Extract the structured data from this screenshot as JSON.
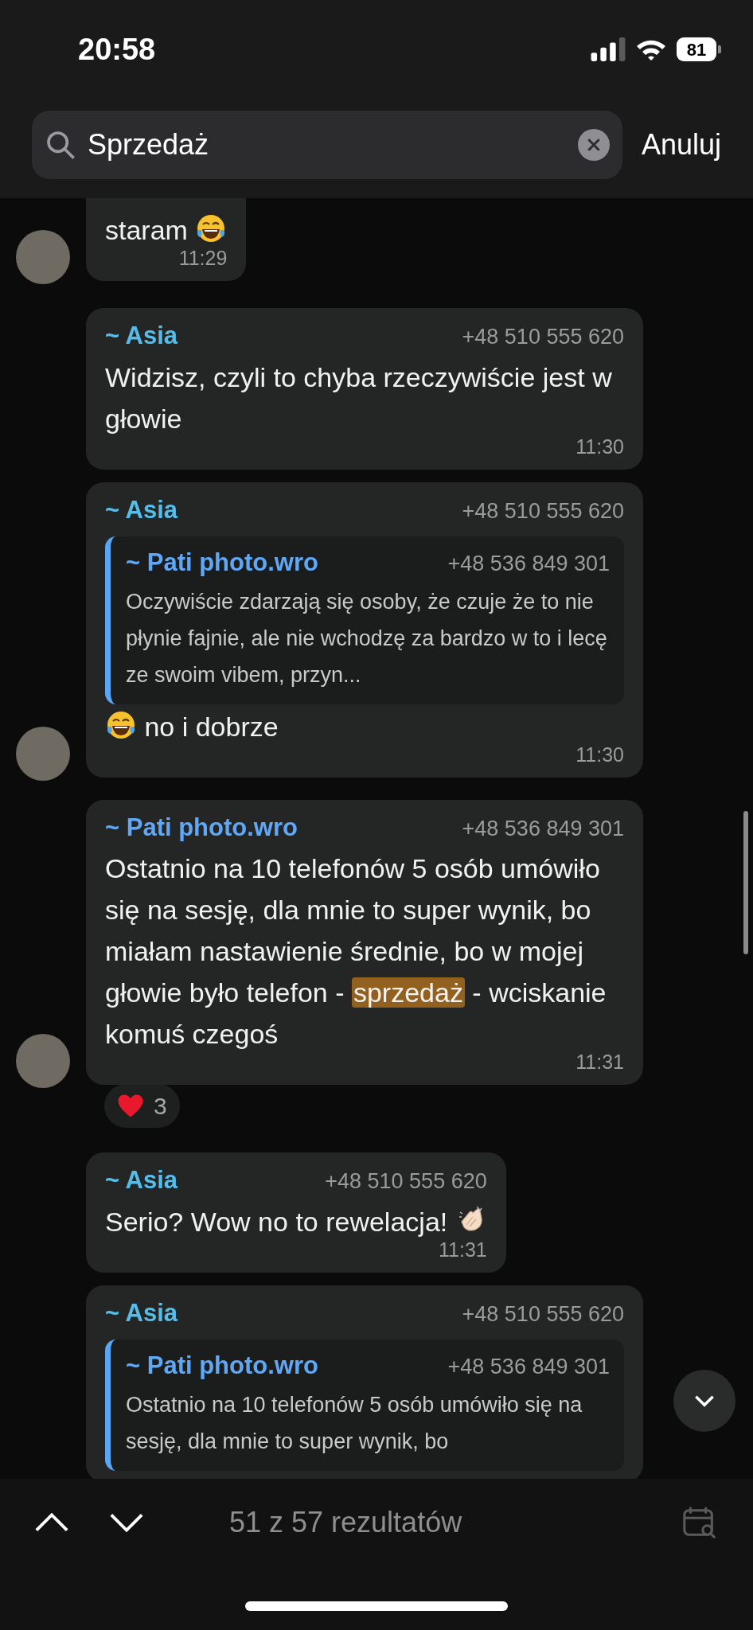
{
  "status_bar": {
    "time": "20:58",
    "battery": "81"
  },
  "search": {
    "value": "Sprzedaż",
    "cancel": "Anuluj"
  },
  "messages": [
    {
      "avatar": true,
      "time": "11:29",
      "segments": [
        {
          "kind": "text",
          "text": "staram "
        },
        {
          "kind": "laugh-emoji"
        }
      ]
    },
    {
      "avatar": false,
      "sender": "~ Asia",
      "color": "#53bdeb",
      "phone": "+48 510 555 620",
      "time": "11:30",
      "segments": [
        {
          "kind": "text",
          "text": "Widzisz, czyli to chyba rzeczywiście jest w głowie"
        }
      ]
    },
    {
      "avatar": true,
      "sender": "~ Asia",
      "color": "#53bdeb",
      "phone": "+48 510 555 620",
      "time": "11:30",
      "quote": {
        "sender": "~ Pati photo.wro",
        "phone": "+48 536 849 301",
        "text": "Oczywiście zdarzają się osoby, że czuje że to nie płynie fajnie, ale nie wchodzę za bardzo w to i lecę ze swoim vibem, przyn..."
      },
      "segments": [
        {
          "kind": "laugh-emoji"
        },
        {
          "kind": "text",
          "text": " no i dobrze"
        }
      ]
    },
    {
      "avatar": true,
      "sender": "~ Pati photo.wro",
      "color": "#5ea8f7",
      "phone": "+48 536 849 301",
      "time": "11:31",
      "segments": [
        {
          "kind": "text",
          "text": "Ostatnio na 10 telefonów 5 osób umówiło się na sesję, dla mnie to super wynik, bo miałam nastawienie średnie, bo w mojej głowie było telefon - "
        },
        {
          "kind": "highlight",
          "text": "sprzedaż"
        },
        {
          "kind": "text",
          "text": " - wciskanie komuś czegoś"
        }
      ],
      "reaction": {
        "count": "3"
      }
    },
    {
      "avatar": false,
      "sender": "~ Asia",
      "color": "#53bdeb",
      "phone": "+48 510 555 620",
      "time": "11:31",
      "segments": [
        {
          "kind": "text",
          "text": "Serio? Wow no to rewelacja! "
        },
        {
          "kind": "clap-emoji"
        }
      ]
    },
    {
      "avatar": false,
      "sender": "~ Asia",
      "color": "#53bdeb",
      "phone": "+48 510 555 620",
      "quote": {
        "sender": "~ Pati photo.wro",
        "phone": "+48 536 849 301",
        "text": "Ostatnio na 10 telefonów 5 osób umówiło się na sesję, dla mnie to super wynik, bo"
      }
    }
  ],
  "results": {
    "text": "51 z 57 rezultatów"
  }
}
